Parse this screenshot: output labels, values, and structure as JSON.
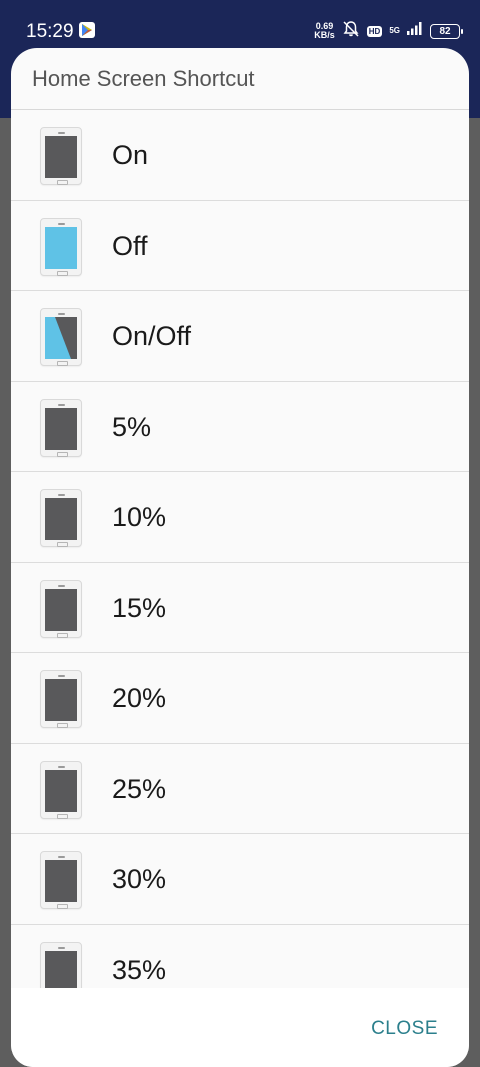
{
  "status_bar": {
    "time": "15:29",
    "network_speed_value": "0.69",
    "network_speed_unit": "KB/s",
    "hd_badge": "HD",
    "network_type": "5G",
    "battery": "82"
  },
  "dialog": {
    "title": "Home Screen Shortcut",
    "items": [
      {
        "label": "On",
        "icon": "phone-screen-on-icon"
      },
      {
        "label": "Off",
        "icon": "phone-screen-off-icon"
      },
      {
        "label": "On/Off",
        "icon": "phone-screen-toggle-icon"
      },
      {
        "label": "5%",
        "icon": "phone-screen-on-icon"
      },
      {
        "label": "10%",
        "icon": "phone-screen-on-icon"
      },
      {
        "label": "15%",
        "icon": "phone-screen-on-icon"
      },
      {
        "label": "20%",
        "icon": "phone-screen-on-icon"
      },
      {
        "label": "25%",
        "icon": "phone-screen-on-icon"
      },
      {
        "label": "30%",
        "icon": "phone-screen-on-icon"
      },
      {
        "label": "35%",
        "icon": "phone-screen-on-icon"
      }
    ],
    "close_label": "CLOSE"
  },
  "colors": {
    "status_bar_bg": "#1b2658",
    "screen_on": "#59595b",
    "screen_off": "#5fc2e6",
    "accent": "#2b7f8c"
  }
}
